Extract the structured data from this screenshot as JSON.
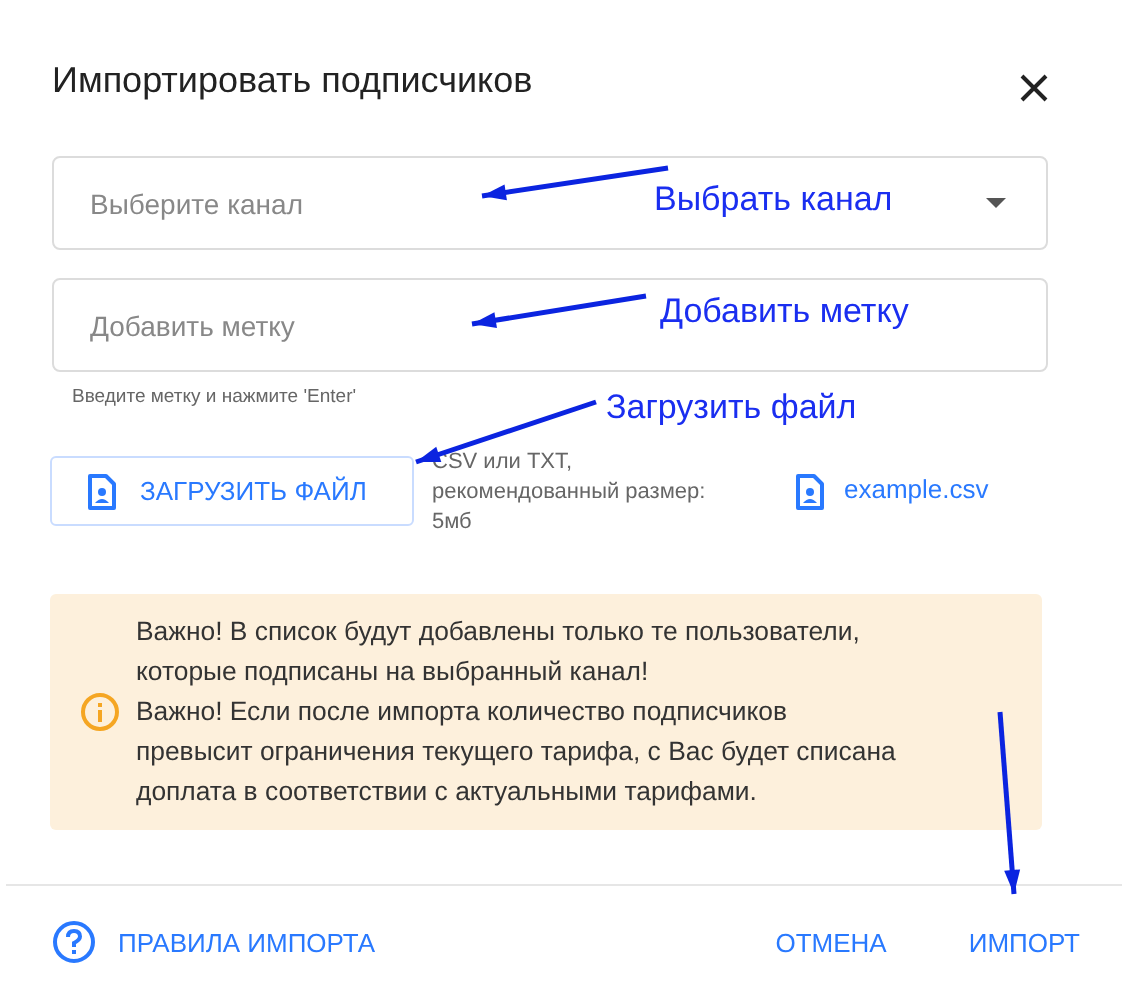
{
  "dialog": {
    "title": "Импортировать подписчиков"
  },
  "channel_select": {
    "placeholder": "Выберите канал"
  },
  "tag_field": {
    "placeholder": "Добавить метку",
    "hint": "Введите метку и нажмите 'Enter'"
  },
  "upload": {
    "button": "ЗАГРУЗИТЬ ФАЙЛ",
    "note": [
      "CSV или TXT,",
      "рекомендованный размер:",
      "5мб"
    ],
    "example_link": "example.csv"
  },
  "notice": {
    "lines": [
      "Важно! В список будут добавлены только те пользователи,",
      "которые подписаны на выбранный канал!",
      "Важно! Если после импорта количество подписчиков",
      "превысит ограничения текущего тарифа, с Вас будет списана",
      "доплата в соответствии с актуальными тарифами."
    ]
  },
  "footer": {
    "help_link": "ПРАВИЛА ИМПОРТА",
    "buttons": [
      "ОТМЕНА",
      "ИМПОРТ"
    ]
  },
  "annotations": [
    {
      "text": "Выбрать канал"
    },
    {
      "text": "Добавить метку"
    },
    {
      "text": "Загрузить файл"
    }
  ]
}
